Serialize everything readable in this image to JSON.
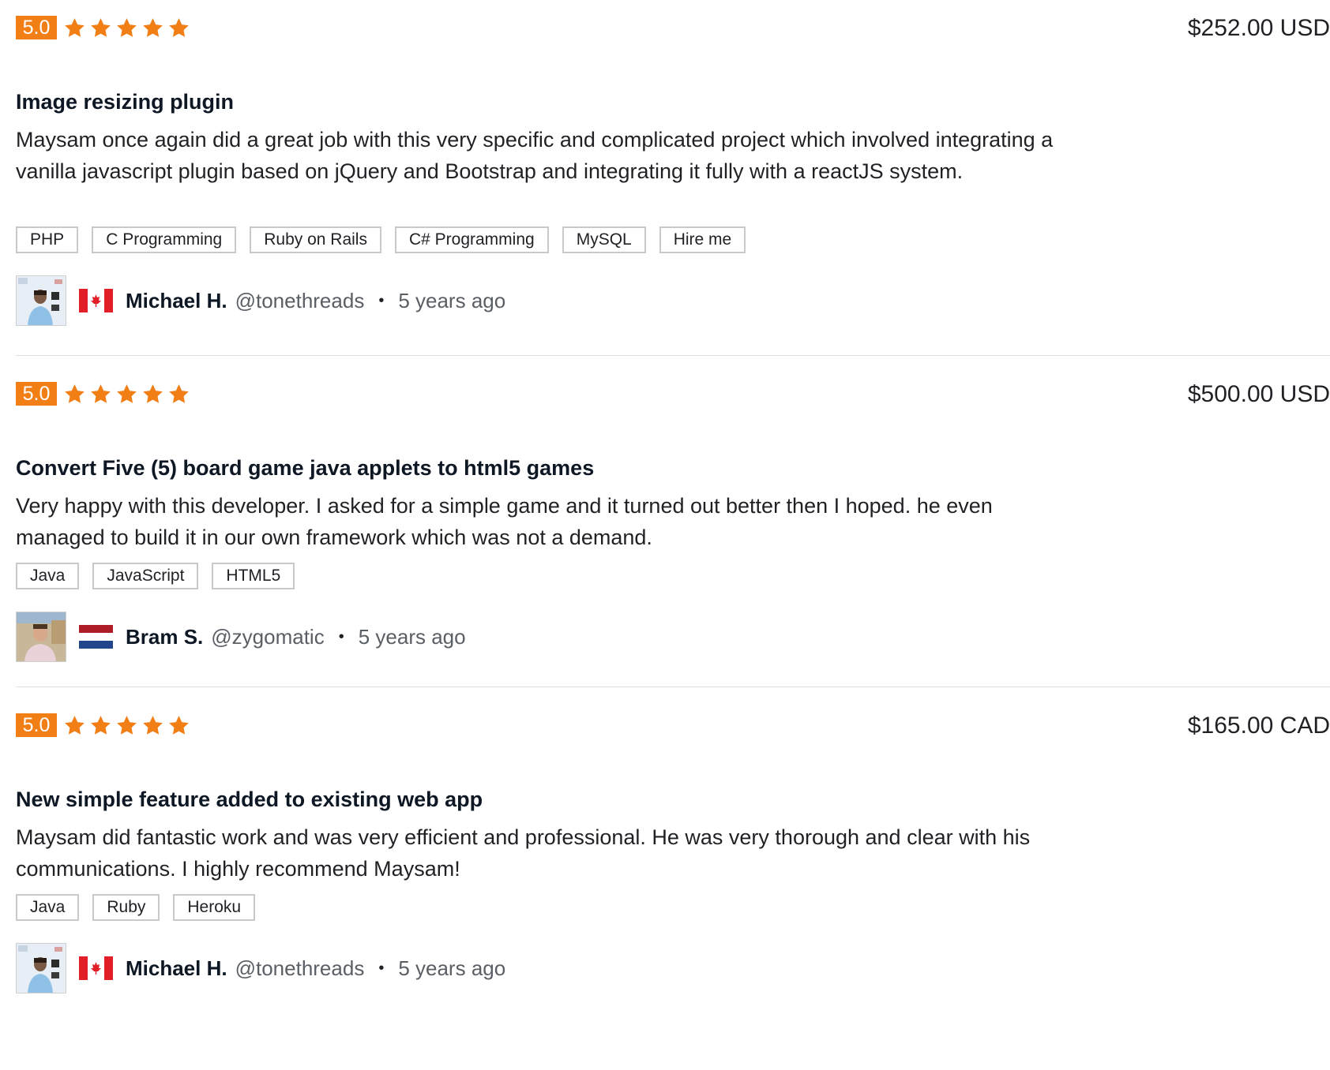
{
  "reviews": [
    {
      "rating": "5.0",
      "stars": 5,
      "price": "$252.00 USD",
      "title": "Image resizing plugin",
      "description": "Maysam once again did a great job with this very specific and complicated project which involved integrating a vanilla javascript plugin based on jQuery and Bootstrap and integrating it fully with a reactJS system.",
      "tags": [
        "PHP",
        "C Programming",
        "Ruby on Rails",
        "C# Programming",
        "MySQL",
        "Hire me"
      ],
      "reviewer": {
        "name": "Michael H.",
        "handle": "@tonethreads",
        "separator": "•",
        "time": "5 years ago",
        "flag": "canada-flag-icon"
      }
    },
    {
      "rating": "5.0",
      "stars": 5,
      "price": "$500.00 USD",
      "title": "Convert Five (5) board game java applets to html5 games",
      "description": "Very happy with this developer. I asked for a simple game and it turned out better then I hoped. he even managed to build it in our own framework which was not a demand.",
      "tags": [
        "Java",
        "JavaScript",
        "HTML5"
      ],
      "reviewer": {
        "name": "Bram S.",
        "handle": "@zygomatic",
        "separator": "•",
        "time": "5 years ago",
        "flag": "netherlands-flag-icon"
      }
    },
    {
      "rating": "5.0",
      "stars": 5,
      "price": "$165.00 CAD",
      "title": "New simple feature added to existing web app",
      "description": "Maysam did fantastic work and was very efficient and professional. He was very thorough and clear with his communications. I highly recommend Maysam!",
      "tags": [
        "Java",
        "Ruby",
        "Heroku"
      ],
      "reviewer": {
        "name": "Michael H.",
        "handle": "@tonethreads",
        "separator": "•",
        "time": "5 years ago",
        "flag": "canada-flag-icon"
      }
    }
  ],
  "colors": {
    "rating_badge": "#f27e16",
    "star": "#f27e16",
    "tag_border": "#c9c9c9",
    "divider": "#dedede"
  }
}
